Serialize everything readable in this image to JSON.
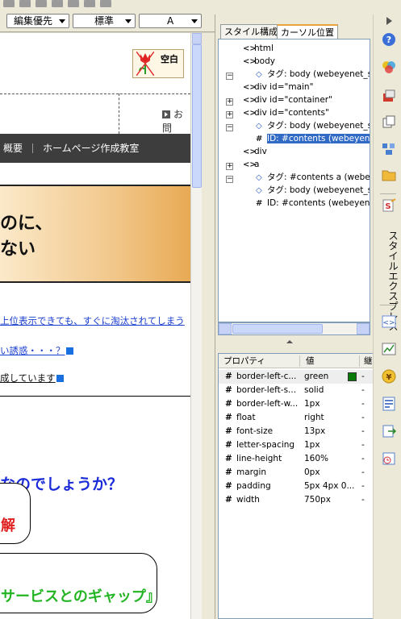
{
  "toolbar": {
    "dropdown_edit_mode": "編集優先",
    "dropdown_style": "標準",
    "dropdown_font": "A"
  },
  "page": {
    "empty_label": "空白",
    "otoiawase": "お問",
    "nav_items": [
      "概要",
      "ホームページ作成教室"
    ],
    "banner_line1": "のに、",
    "banner_line2": "ない",
    "link1": "上位表示できても、すぐに淘汰されてしまう",
    "link2": "い誘惑・・・？",
    "link3": "成しています",
    "question": "なのでしょうか？",
    "bubble1": "解",
    "bubble2": "サービスとのギャップ』"
  },
  "panel": {
    "tab_style": "スタイル構成",
    "tab_cursor": "カーソル位置",
    "tree": [
      {
        "label": "html",
        "icon": "tag-icon"
      },
      {
        "label": "body",
        "icon": "tag-icon"
      },
      {
        "label": "タグ: body (webeyenet_sty",
        "icon": "style-tag-icon"
      },
      {
        "label": "div id=\"main\"",
        "icon": "tag-icon"
      },
      {
        "label": "div id=\"container\"",
        "icon": "tag-icon"
      },
      {
        "label": "div id=\"contents\"",
        "icon": "tag-icon"
      },
      {
        "label": "タグ: body (webeyenet_sty",
        "icon": "style-tag-icon"
      },
      {
        "label": "ID: #contents (webeyenet",
        "icon": "id-rule-icon"
      },
      {
        "label": "div",
        "icon": "tag-icon"
      },
      {
        "label": "a",
        "icon": "tag-icon"
      },
      {
        "label": "タグ: #contents a (webeye",
        "icon": "style-tag-icon"
      },
      {
        "label": "タグ: body (webeyenet_sty",
        "icon": "style-tag-icon"
      },
      {
        "label": "ID: #contents (webeyenet",
        "icon": "id-rule-icon"
      }
    ],
    "props_header": {
      "property": "プロパティ",
      "value": "値",
      "extra": "継"
    },
    "properties": [
      {
        "name": "border-left-c...",
        "value": "green",
        "extra": "-"
      },
      {
        "name": "border-left-s...",
        "value": "solid",
        "extra": "-"
      },
      {
        "name": "border-left-w...",
        "value": "1px",
        "extra": "-"
      },
      {
        "name": "float",
        "value": "right",
        "extra": "-"
      },
      {
        "name": "font-size",
        "value": "13px",
        "extra": "-"
      },
      {
        "name": "letter-spacing",
        "value": "1px",
        "extra": "-"
      },
      {
        "name": "line-height",
        "value": "160%",
        "extra": "-"
      },
      {
        "name": "margin",
        "value": "0px",
        "extra": "-"
      },
      {
        "name": "padding",
        "value": "5px 4px 0...",
        "extra": "-"
      },
      {
        "name": "width",
        "value": "750px",
        "extra": "-"
      }
    ],
    "swatch_color": "#0a7a0a"
  },
  "sidebar": {
    "vertical_label": "スタイルエクスプレス"
  }
}
